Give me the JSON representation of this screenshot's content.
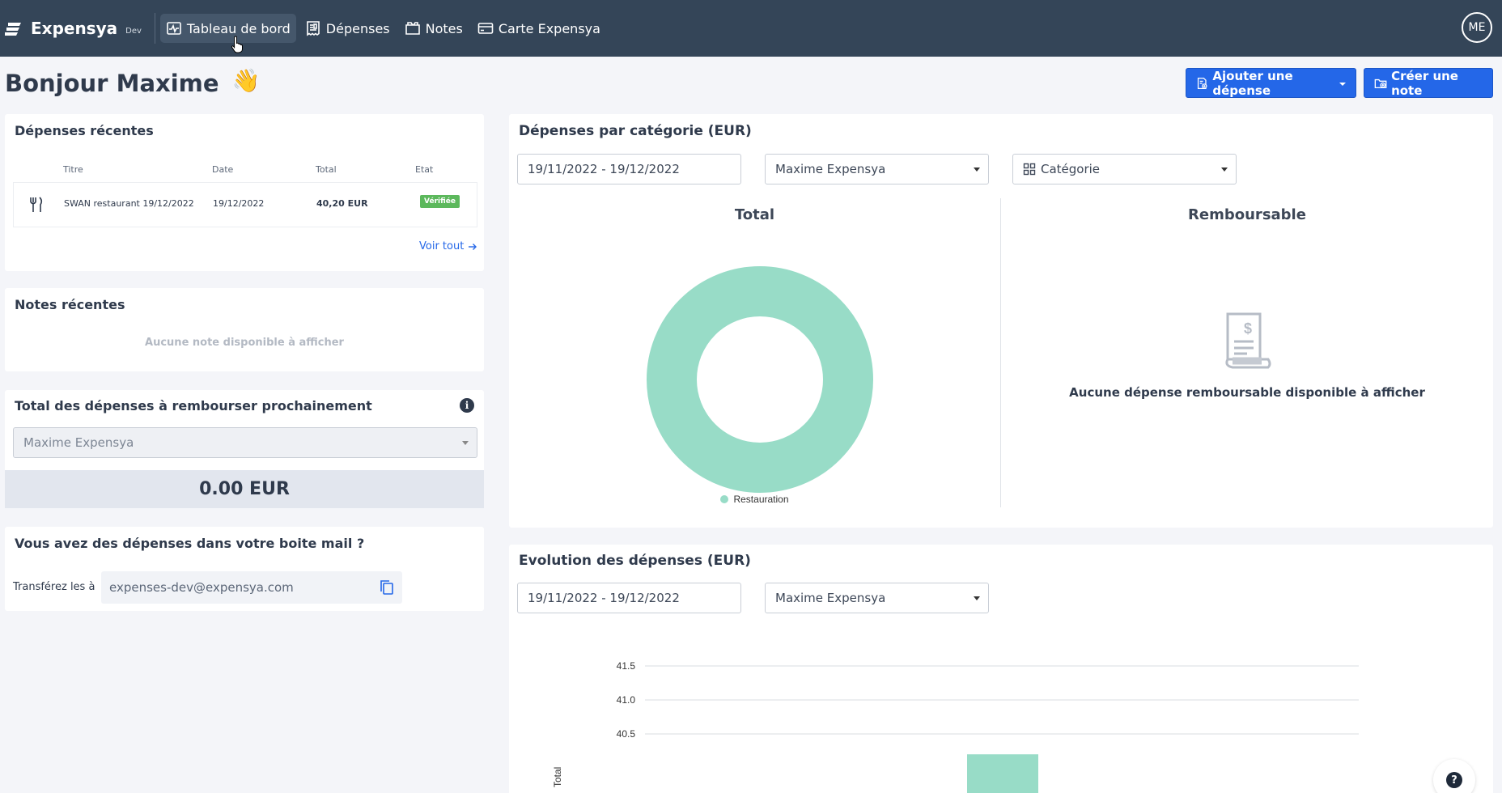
{
  "nav": {
    "brand": "Expensya",
    "env": "Dev",
    "items": [
      {
        "label": "Tableau de bord",
        "icon": "dashboard-icon"
      },
      {
        "label": "Dépenses",
        "icon": "receipt-icon"
      },
      {
        "label": "Notes",
        "icon": "folder-icon"
      },
      {
        "label": "Carte Expensya",
        "icon": "card-icon"
      }
    ],
    "avatar": "ME"
  },
  "greeting": "Bonjour Maxime",
  "actions": {
    "add_expense": "Ajouter une dépense",
    "create_note": "Créer une note"
  },
  "recent_expenses": {
    "title": "Dépenses récentes",
    "columns": [
      "Titre",
      "Date",
      "Total",
      "Etat"
    ],
    "rows": [
      {
        "title": "SWAN restaurant 19/12/2022",
        "date": "19/12/2022",
        "total": "40,20 EUR",
        "status": "Vérifiée"
      }
    ],
    "see_all": "Voir tout"
  },
  "recent_notes": {
    "title": "Notes récentes",
    "empty": "Aucune note disponible à afficher"
  },
  "reimburse": {
    "title": "Total des dépenses à rembourser prochainement",
    "user": "Maxime Expensya",
    "amount": "0.00 EUR"
  },
  "mailbox": {
    "title": "Vous avez des dépenses dans votre boite mail ?",
    "label": "Transférez les à",
    "email": "expenses-dev@expensya.com"
  },
  "by_category": {
    "title": "Dépenses par catégorie (EUR)",
    "date_range": "19/11/2022 - 19/12/2022",
    "user": "Maxime Expensya",
    "group_by": "Catégorie",
    "total_heading": "Total",
    "refundable_heading": "Remboursable",
    "refundable_empty": "Aucune dépense remboursable disponible à afficher",
    "colors": {
      "restauration": "#98dcc7"
    }
  },
  "evolution": {
    "title": "Evolution des dépenses (EUR)",
    "date_range": "19/11/2022 - 19/12/2022",
    "user": "Maxime Expensya"
  },
  "chart_data": [
    {
      "type": "pie",
      "categories": [
        "Restauration"
      ],
      "values": [
        40.2
      ],
      "title": "Total",
      "legend": "bottom"
    },
    {
      "type": "bar",
      "categories": [
        ""
      ],
      "values": [
        40.2
      ],
      "ylabel": "Total",
      "yticks": [
        40.5,
        41.0,
        41.5
      ],
      "grid": true
    }
  ]
}
